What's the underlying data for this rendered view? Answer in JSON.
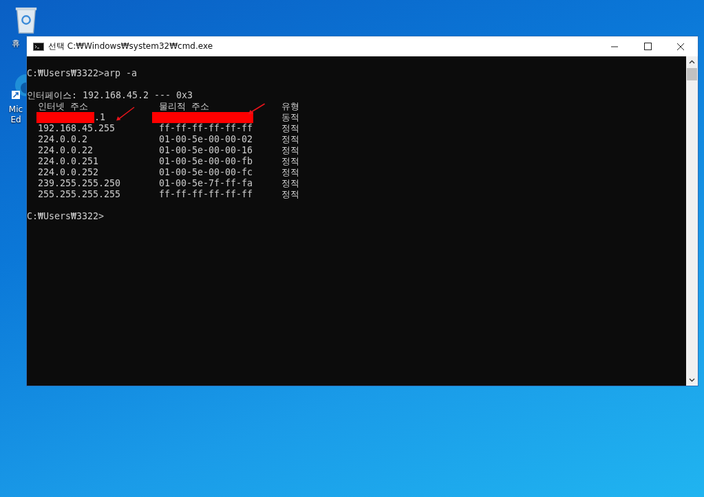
{
  "desktop_icons": [
    {
      "kind": "recycle-bin",
      "label_lines": [
        "휴"
      ]
    },
    {
      "kind": "browser",
      "label_lines": [
        "Mic",
        "Ed"
      ]
    }
  ],
  "window": {
    "title": "선택 C:₩Windows₩system32₩cmd.exe"
  },
  "console": {
    "command_line": "C:₩Users₩3322>arp -a",
    "interface_line": "인터페이스: 192.168.45.2 --- 0x3",
    "columns": [
      "인터넷 주소",
      "물리적 주소",
      "유형"
    ],
    "rows": [
      {
        "internet_address": ".1",
        "internet_redacted": true,
        "physical_redacted": true,
        "type": "동적"
      },
      {
        "internet_address": "192.168.45.255",
        "internet_redacted": false,
        "physical_address": "ff-ff-ff-ff-ff-ff",
        "physical_redacted": false,
        "type": "정적"
      },
      {
        "internet_address": "224.0.0.2",
        "internet_redacted": false,
        "physical_address": "01-00-5e-00-00-02",
        "physical_redacted": false,
        "type": "정적"
      },
      {
        "internet_address": "224.0.0.22",
        "internet_redacted": false,
        "physical_address": "01-00-5e-00-00-16",
        "physical_redacted": false,
        "type": "정적"
      },
      {
        "internet_address": "224.0.0.251",
        "internet_redacted": false,
        "physical_address": "01-00-5e-00-00-fb",
        "physical_redacted": false,
        "type": "정적"
      },
      {
        "internet_address": "224.0.0.252",
        "internet_redacted": false,
        "physical_address": "01-00-5e-00-00-fc",
        "physical_redacted": false,
        "type": "정적"
      },
      {
        "internet_address": "239.255.255.250",
        "internet_redacted": false,
        "physical_address": "01-00-5e-7f-ff-fa",
        "physical_redacted": false,
        "type": "정적"
      },
      {
        "internet_address": "255.255.255.255",
        "internet_redacted": false,
        "physical_address": "ff-ff-ff-ff-ff-ff",
        "physical_redacted": false,
        "type": "정적"
      }
    ],
    "prompt": "C:₩Users₩3322>"
  }
}
